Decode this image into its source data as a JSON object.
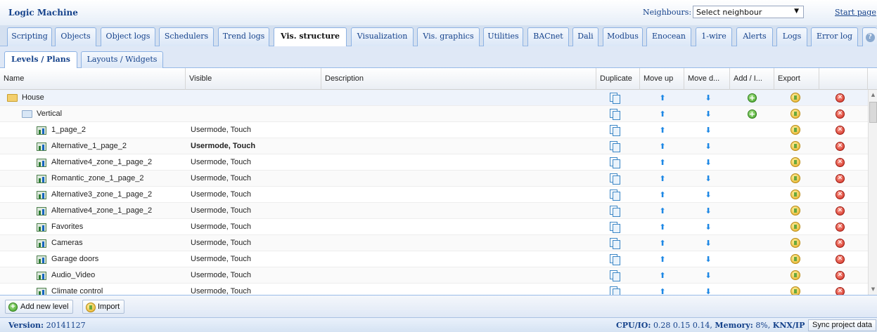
{
  "app": {
    "title": "Logic Machine"
  },
  "neighbours": {
    "label": "Neighbours:",
    "selected": "Select neighbour",
    "start_page": "Start page"
  },
  "tabs": [
    {
      "label": "Scripting",
      "active": false
    },
    {
      "label": "Objects",
      "active": false
    },
    {
      "label": "Object logs",
      "active": false
    },
    {
      "label": "Schedulers",
      "active": false
    },
    {
      "label": "Trend logs",
      "active": false
    },
    {
      "label": "Vis. structure",
      "active": true
    },
    {
      "label": "Visualization",
      "active": false
    },
    {
      "label": "Vis. graphics",
      "active": false
    },
    {
      "label": "Utilities",
      "active": false
    },
    {
      "label": "BACnet",
      "active": false
    },
    {
      "label": "Dali",
      "active": false
    },
    {
      "label": "Modbus",
      "active": false
    },
    {
      "label": "Enocean",
      "active": false
    },
    {
      "label": "1-wire",
      "active": false
    },
    {
      "label": "Alerts",
      "active": false
    },
    {
      "label": "Logs",
      "active": false
    },
    {
      "label": "Error log",
      "active": false
    }
  ],
  "subtabs": [
    {
      "label": "Levels / Plans",
      "active": true
    },
    {
      "label": "Layouts / Widgets",
      "active": false
    }
  ],
  "grid": {
    "columns": {
      "name": "Name",
      "visible": "Visible",
      "description": "Description",
      "duplicate": "Duplicate",
      "move_up": "Move up",
      "move_down": "Move d...",
      "add": "Add / I...",
      "export": "Export"
    },
    "rows": [
      {
        "name": "House",
        "visible": "",
        "type": "folder",
        "level": 0,
        "add": true,
        "bold": false
      },
      {
        "name": "Vertical",
        "visible": "",
        "type": "folder-open",
        "level": 1,
        "add": true,
        "bold": false
      },
      {
        "name": "1_page_2",
        "visible": "Usermode, Touch",
        "type": "page",
        "level": 2,
        "add": false,
        "bold": false
      },
      {
        "name": "Alternative_1_page_2",
        "visible": "Usermode, Touch",
        "type": "page",
        "level": 2,
        "add": false,
        "bold": true
      },
      {
        "name": "Alternative4_zone_1_page_2",
        "visible": "Usermode, Touch",
        "type": "page",
        "level": 2,
        "add": false,
        "bold": false
      },
      {
        "name": "Romantic_zone_1_page_2",
        "visible": "Usermode, Touch",
        "type": "page",
        "level": 2,
        "add": false,
        "bold": false
      },
      {
        "name": "Alternative3_zone_1_page_2",
        "visible": "Usermode, Touch",
        "type": "page",
        "level": 2,
        "add": false,
        "bold": false
      },
      {
        "name": "Alternative4_zone_1_page_2",
        "visible": "Usermode, Touch",
        "type": "page",
        "level": 2,
        "add": false,
        "bold": false
      },
      {
        "name": "Favorites",
        "visible": "Usermode, Touch",
        "type": "page",
        "level": 2,
        "add": false,
        "bold": false
      },
      {
        "name": "Cameras",
        "visible": "Usermode, Touch",
        "type": "page",
        "level": 2,
        "add": false,
        "bold": false
      },
      {
        "name": "Garage doors",
        "visible": "Usermode, Touch",
        "type": "page",
        "level": 2,
        "add": false,
        "bold": false
      },
      {
        "name": "Audio_Video",
        "visible": "Usermode, Touch",
        "type": "page",
        "level": 2,
        "add": false,
        "bold": false
      },
      {
        "name": "Climate control",
        "visible": "Usermode, Touch",
        "type": "page",
        "level": 2,
        "add": false,
        "bold": false
      }
    ]
  },
  "toolbar": {
    "add_level": "Add new level",
    "import": "Import"
  },
  "status": {
    "version_label": "Version:",
    "version": "20141127",
    "cpu_label": "CPU/IO:",
    "cpu": "0.28 0.15 0.14,",
    "memory_label": "Memory:",
    "memory": "8%,",
    "knx": "KNX/IP",
    "sync": "Sync project data"
  },
  "icons": {
    "folder": "folder-icon",
    "page": "page-icon",
    "duplicate": "duplicate-icon",
    "move_up": "arrow-up-icon",
    "move_down": "arrow-down-icon",
    "add": "add-icon",
    "export": "export-icon",
    "delete": "delete-icon"
  }
}
